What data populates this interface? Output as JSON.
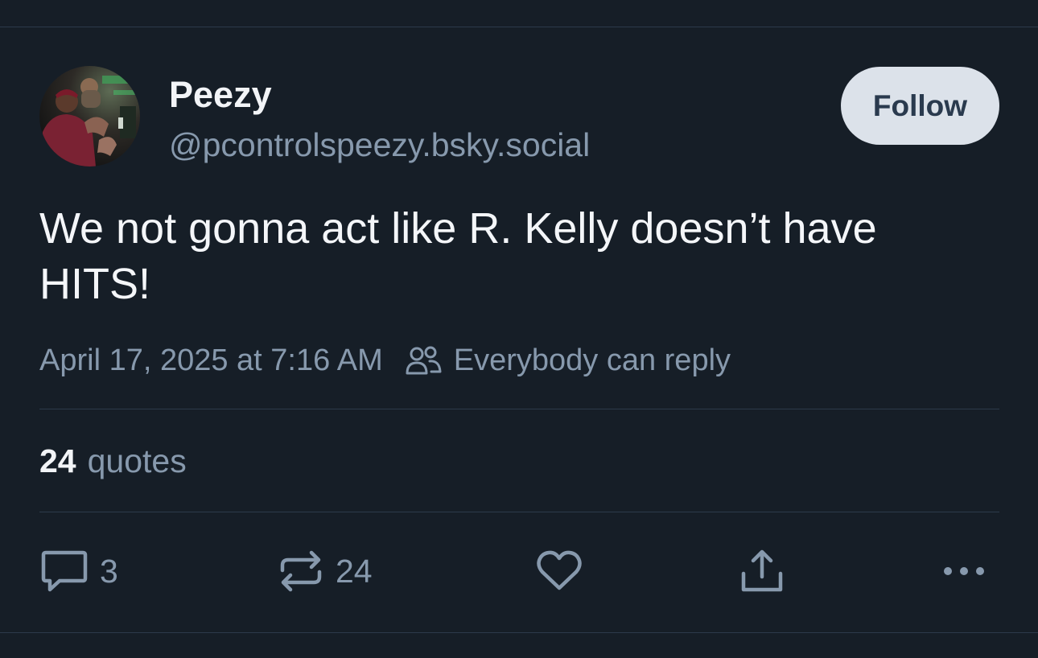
{
  "author": {
    "display_name": "Peezy",
    "handle": "@pcontrolspeezy.bsky.social",
    "follow_label": "Follow"
  },
  "post": {
    "text": "We not gonna act like R. Kelly doesn’t have\nHITS!",
    "timestamp": "April 17, 2025 at 7:16 AM",
    "reply_setting": "Everybody can reply"
  },
  "stats": {
    "quotes_count": "24",
    "quotes_label": "quotes"
  },
  "actions": {
    "reply_count": "3",
    "repost_count": "24",
    "icons": [
      "reply-icon",
      "repost-icon",
      "like-icon",
      "share-icon",
      "more-icon"
    ]
  },
  "colors": {
    "background": "#161e27",
    "muted_text": "#8799ad",
    "follow_button_bg": "#dce2ea",
    "follow_button_text": "#2a3a4e"
  }
}
